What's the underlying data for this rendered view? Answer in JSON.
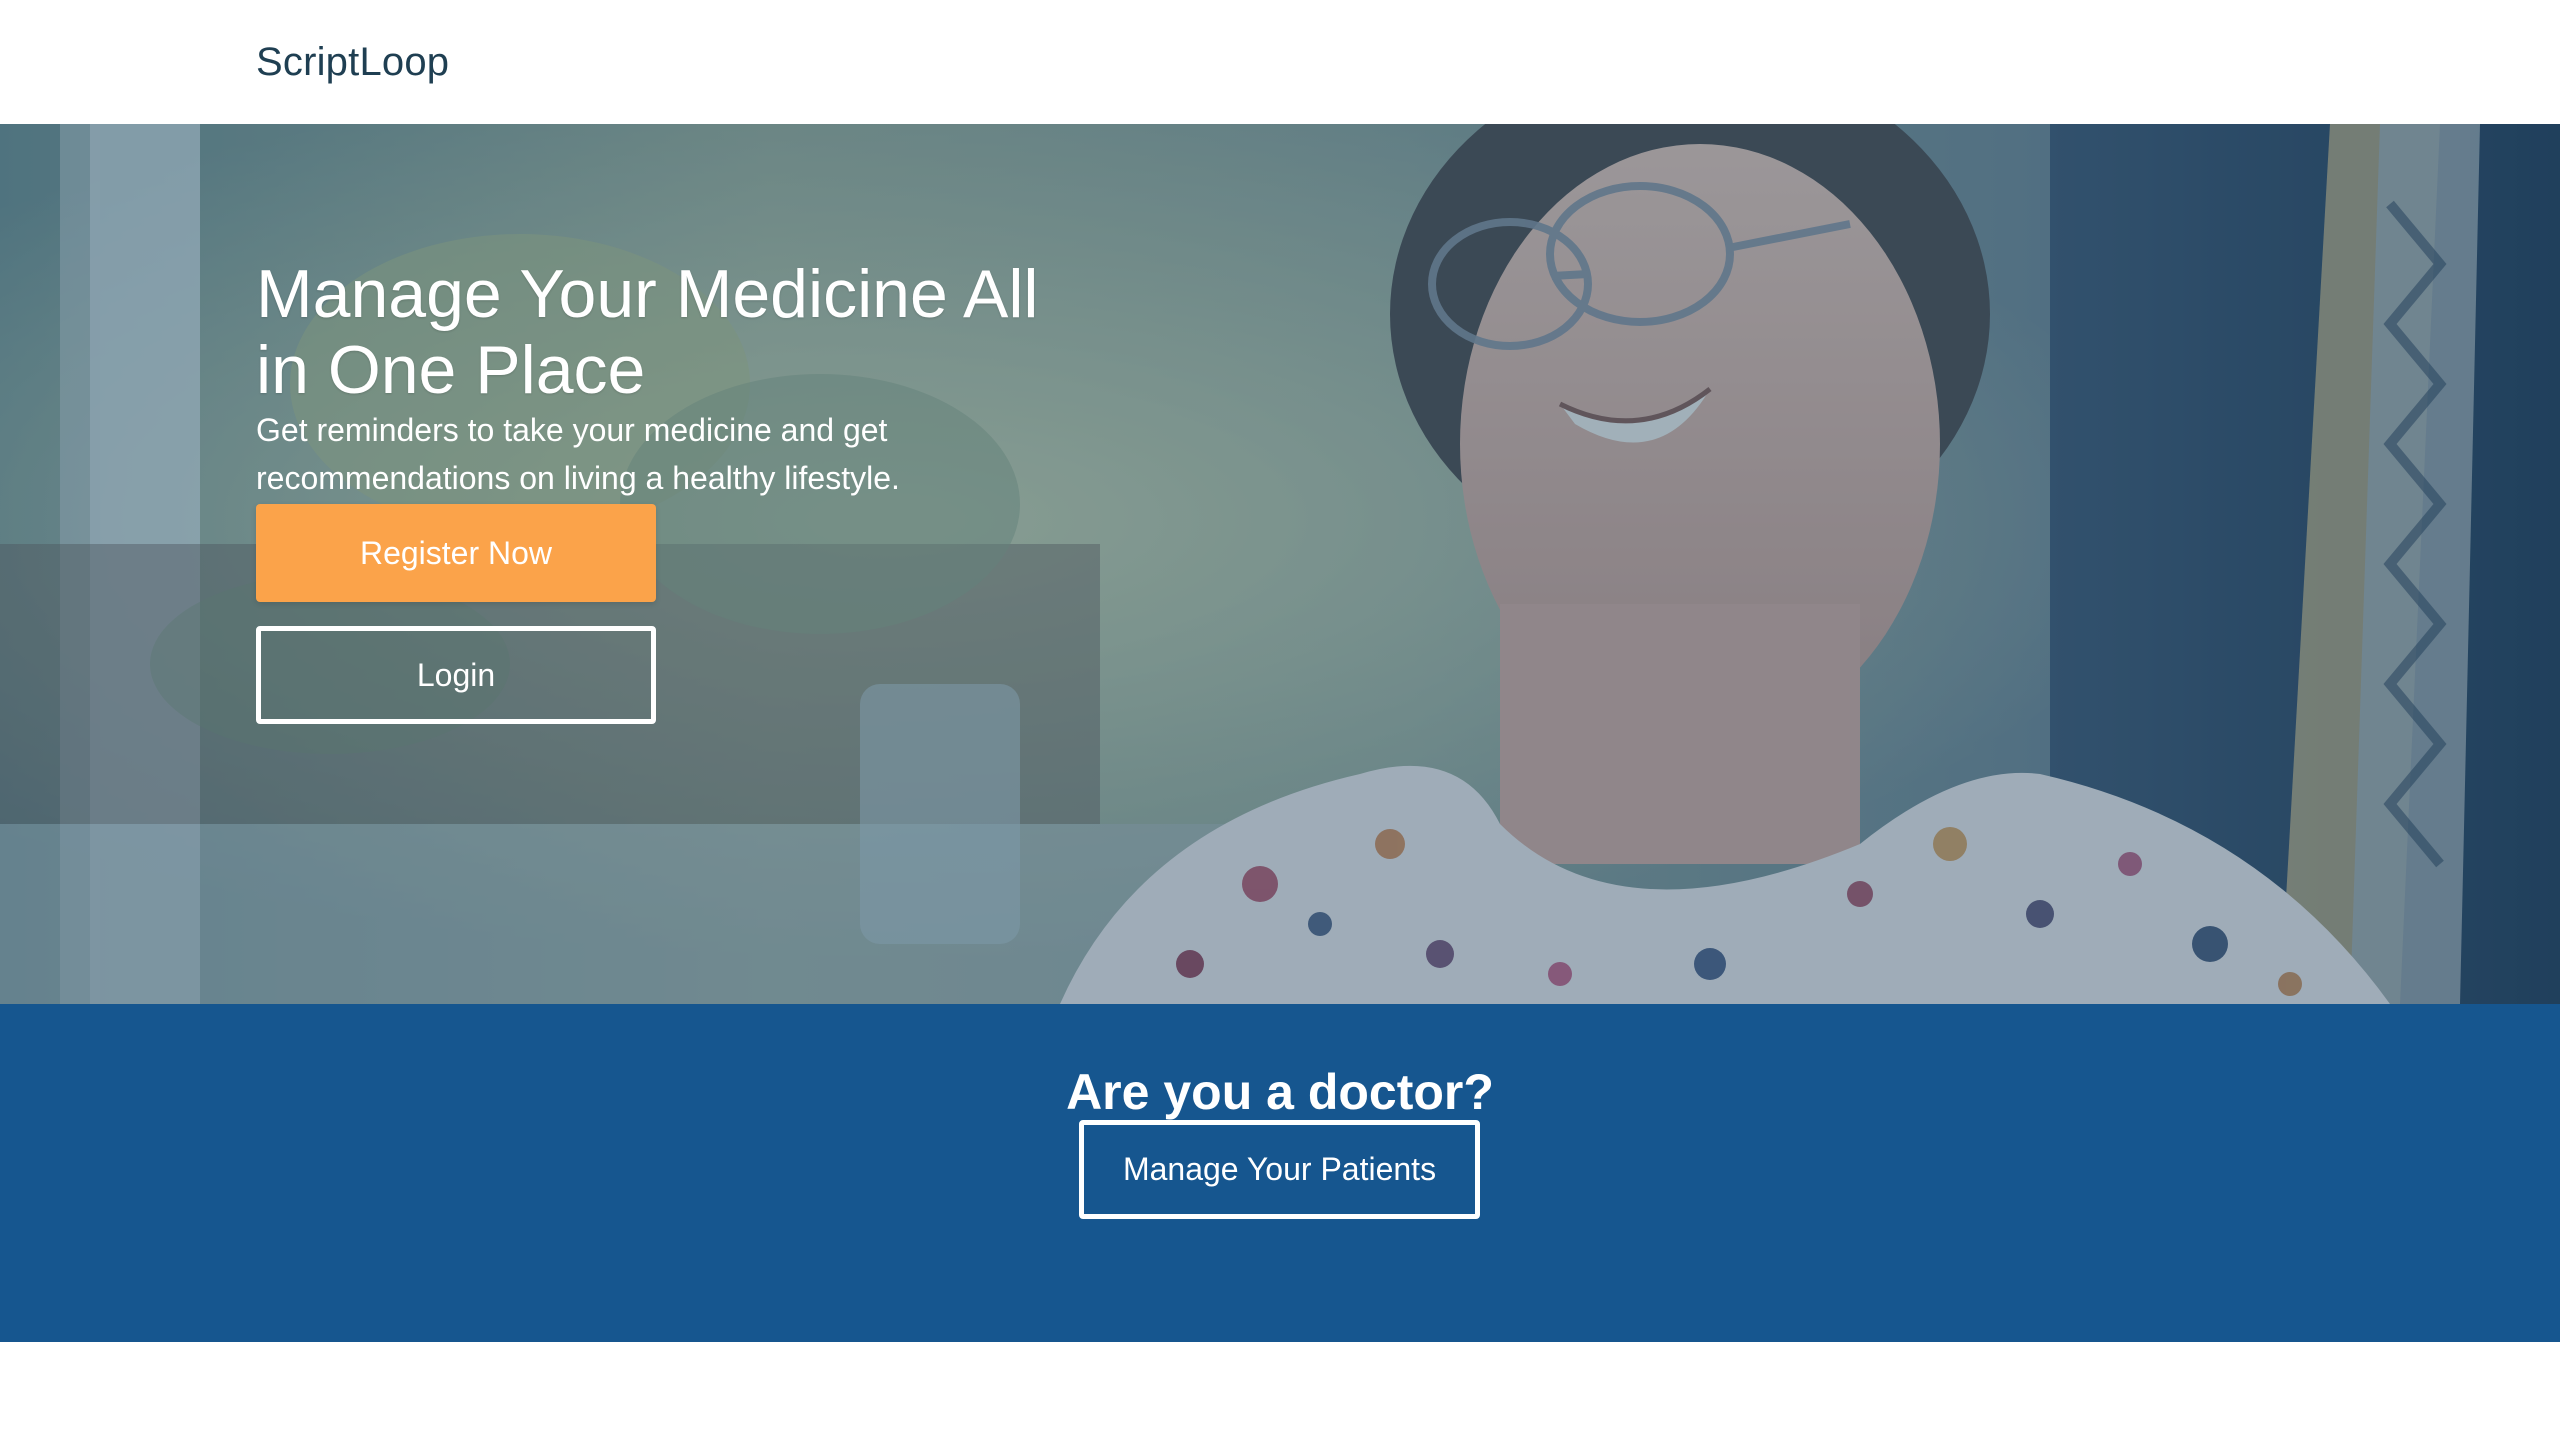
{
  "navbar": {
    "brand": "ScriptLoop"
  },
  "hero": {
    "title": "Manage Your Medicine All in One Place",
    "subtitle": "Get reminders to take your medicine and get recommendations on living a healthy lifestyle.",
    "register_label": "Register Now",
    "login_label": "Login",
    "photo_icon": "smiling-elderly-woman-photo"
  },
  "doctor": {
    "title": "Are you a doctor?",
    "patients_label": "Manage Your Patients"
  },
  "colors": {
    "brand_text": "#1f3f52",
    "accent_orange": "#fba34a",
    "doctor_band": "#16568f",
    "hero_overlay": "#1e4e78"
  }
}
